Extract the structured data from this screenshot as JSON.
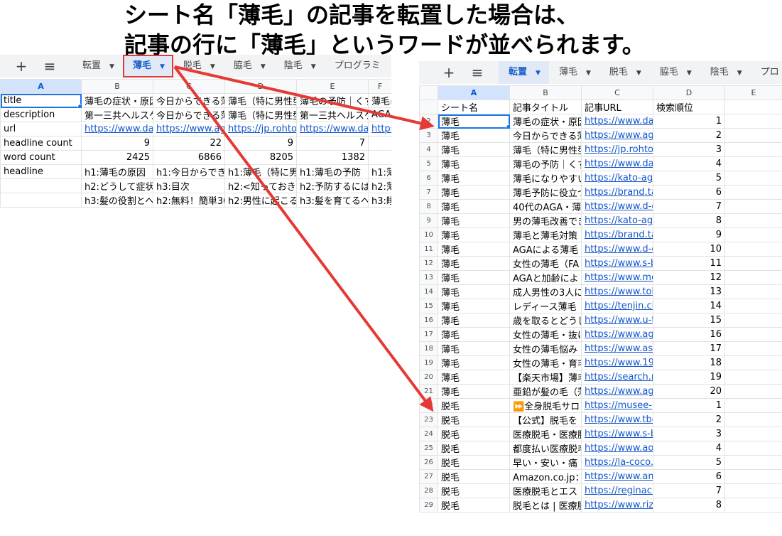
{
  "caption": {
    "line1": "シート名「薄毛」の記事を転置した場合は、",
    "line2": "記事の行に「薄毛」というワードが並べられます。"
  },
  "colors": {
    "accent": "#1a5fc8",
    "arrow": "#e53935",
    "link": "#1155cc",
    "selection": "#1a73e8"
  },
  "left_sheet": {
    "toolbar": {
      "add_label": "+",
      "menu_label": "≡"
    },
    "tabs": [
      {
        "label": "転置",
        "active": false
      },
      {
        "label": "薄毛",
        "active": true
      },
      {
        "label": "脱毛",
        "active": false
      },
      {
        "label": "脇毛",
        "active": false
      },
      {
        "label": "陰毛",
        "active": false
      },
      {
        "label": "プログラミ",
        "active": false
      }
    ],
    "columns": [
      "A",
      "B",
      "C",
      "D",
      "E",
      "F"
    ],
    "rows": [
      {
        "label": "title",
        "cells": [
          "薄毛の症状・原因",
          "今日からできる薄",
          "薄毛（特に男性型",
          "薄毛の予防｜くす",
          "薄毛に"
        ]
      },
      {
        "label": "description",
        "cells": [
          "第一三共ヘルスケ",
          "今日からできる薄",
          "薄毛（特に男性型",
          "第一三共ヘルスケ",
          "AGA"
        ]
      },
      {
        "label": "url",
        "cells": [
          "https://www.daiic",
          "https://www.agas",
          "https://jp.rohto.co",
          "https://www.daiic",
          "https"
        ],
        "link": true
      },
      {
        "label": "headline count",
        "cells": [
          "9",
          "22",
          "9",
          "7",
          ""
        ],
        "numeric": true
      },
      {
        "label": "word count",
        "cells": [
          "2425",
          "6866",
          "8205",
          "1382",
          ""
        ],
        "numeric": true
      },
      {
        "label": "headline",
        "cells": [
          "h1:薄毛の原因",
          "h1:今日からでき",
          "h1:薄毛（特に男",
          "h1:薄毛の予防",
          "h1:薄"
        ]
      },
      {
        "label": "",
        "cells": [
          "h2:どうして症状",
          "h3:目次",
          "h2:<知っておき",
          "h2:予防するには",
          "h2:薄"
        ]
      },
      {
        "label": "",
        "cells": [
          "h3:髪の役割とへ",
          "h2:無料！簡単30",
          "h2:男性に起こる",
          "h3:髪を育てるへ",
          "h3:睡"
        ]
      }
    ]
  },
  "right_sheet": {
    "toolbar": {
      "add_label": "+",
      "menu_label": "≡"
    },
    "tabs": [
      {
        "label": "転置",
        "active": true
      },
      {
        "label": "薄毛",
        "active": false
      },
      {
        "label": "脱毛",
        "active": false
      },
      {
        "label": "脇毛",
        "active": false
      },
      {
        "label": "陰毛",
        "active": false
      },
      {
        "label": "プロ",
        "active": false
      }
    ],
    "columns": [
      "",
      "A",
      "B",
      "C",
      "D",
      "E"
    ],
    "header": [
      "シート名",
      "記事タイトル",
      "記事URL",
      "検索順位"
    ],
    "rows": [
      {
        "num": "2",
        "sheet": "薄毛",
        "title": "薄毛の症状・原因",
        "url": "https://www.daiic",
        "rank": "1"
      },
      {
        "num": "3",
        "sheet": "薄毛",
        "title": "今日からできる薄",
        "url": "https://www.agas",
        "rank": "2"
      },
      {
        "num": "4",
        "sheet": "薄毛",
        "title": "薄毛（特に男性型",
        "url": "https://jp.rohto.co",
        "rank": "3"
      },
      {
        "num": "5",
        "sheet": "薄毛",
        "title": "薄毛の予防｜くす",
        "url": "https://www.daiic",
        "rank": "4"
      },
      {
        "num": "6",
        "sheet": "薄毛",
        "title": "薄毛になりやすい",
        "url": "https://kato-aga-",
        "rank": "5"
      },
      {
        "num": "7",
        "sheet": "薄毛",
        "title": "薄毛予防に役立つ",
        "url": "https://brand.tais",
        "rank": "6"
      },
      {
        "num": "8",
        "sheet": "薄毛",
        "title": "40代のAGA・薄",
        "url": "https://www.d-cli",
        "rank": "7"
      },
      {
        "num": "9",
        "sheet": "薄毛",
        "title": "男の薄毛改善でき",
        "url": "https://kato-aga-",
        "rank": "8"
      },
      {
        "num": "10",
        "sheet": "薄毛",
        "title": "薄毛と薄毛対策",
        "url": "https://brand.tais",
        "rank": "9"
      },
      {
        "num": "11",
        "sheet": "薄毛",
        "title": "AGAによる薄毛",
        "url": "https://www.d-cli",
        "rank": "10"
      },
      {
        "num": "12",
        "sheet": "薄毛",
        "title": "女性の薄毛（FA",
        "url": "https://www.s-b-c",
        "rank": "11"
      },
      {
        "num": "13",
        "sheet": "薄毛",
        "title": "AGAと加齢によ",
        "url": "https://www.mou",
        "rank": "12"
      },
      {
        "num": "14",
        "sheet": "薄毛",
        "title": "成人男性の3人に",
        "url": "https://www.toky",
        "rank": "13"
      },
      {
        "num": "15",
        "sheet": "薄毛",
        "title": "レディース薄毛",
        "url": "https://tenjin.clini",
        "rank": "14"
      },
      {
        "num": "16",
        "sheet": "薄毛",
        "title": "歳を取るとどうし",
        "url": "https://www.u-tok",
        "rank": "15"
      },
      {
        "num": "17",
        "sheet": "薄毛",
        "title": "女性の薄毛・抜け",
        "url": "https://www.agas",
        "rank": "16"
      },
      {
        "num": "18",
        "sheet": "薄毛",
        "title": "女性の薄毛悩み",
        "url": "https://www.asah",
        "rank": "17"
      },
      {
        "num": "19",
        "sheet": "薄毛",
        "title": "女性の薄毛・育毛",
        "url": "https://www.1971",
        "rank": "18"
      },
      {
        "num": "20",
        "sheet": "薄毛",
        "title": "【楽天市場】薄毛",
        "url": "https://search.ral",
        "rank": "19"
      },
      {
        "num": "21",
        "sheet": "薄毛",
        "title": "亜鉛が髪の毛（薄",
        "url": "https://www.agas",
        "rank": "20"
      },
      {
        "num": "22",
        "sheet": "脱毛",
        "title": "⏩全身脱毛サロ",
        "url": "https://musee-pla",
        "rank": "1"
      },
      {
        "num": "23",
        "sheet": "脱毛",
        "title": "【公式】脱毛を",
        "url": "https://www.tbc.c",
        "rank": "2"
      },
      {
        "num": "24",
        "sheet": "脱毛",
        "title": "医療脱毛・医療脱",
        "url": "https://www.s-b-c",
        "rank": "3"
      },
      {
        "num": "25",
        "sheet": "脱毛",
        "title": "都度払い医療脱毛",
        "url": "https://www.aoba",
        "rank": "4"
      },
      {
        "num": "26",
        "sheet": "脱毛",
        "title": "早い・安い・痛",
        "url": "https://la-coco.cc",
        "rank": "5"
      },
      {
        "num": "27",
        "sheet": "脱毛",
        "title": "Amazon.co.jp：脱",
        "url": "https://www.ama",
        "rank": "6"
      },
      {
        "num": "28",
        "sheet": "脱毛",
        "title": "医療脱毛とエス",
        "url": "https://reginaclin",
        "rank": "7"
      },
      {
        "num": "29",
        "sheet": "脱毛",
        "title": "脱毛とは | 医療脱",
        "url": "https://www.rizec",
        "rank": "8"
      }
    ]
  }
}
